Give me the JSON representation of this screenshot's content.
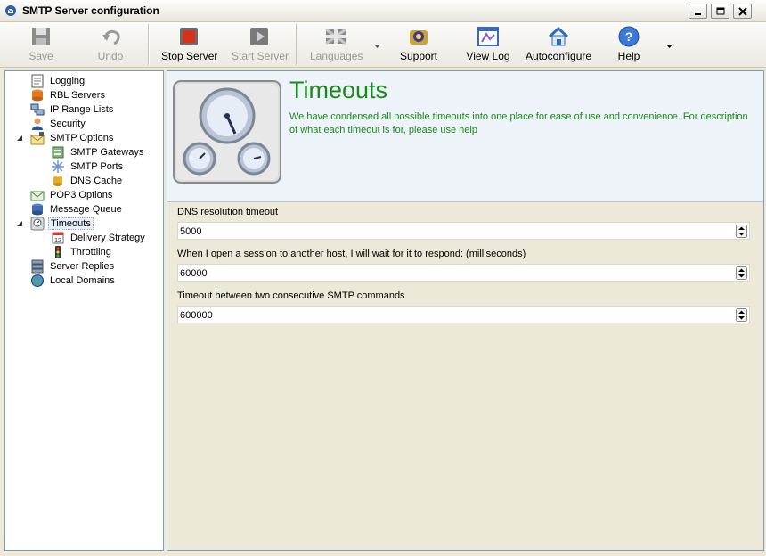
{
  "window": {
    "title": "SMTP Server configuration"
  },
  "toolbar": {
    "save": "Save",
    "undo": "Undo",
    "stop_server": "Stop Server",
    "start_server": "Start Server",
    "languages": "Languages",
    "support": "Support",
    "view_log": "View Log",
    "autoconfigure": "Autoconfigure",
    "help": "Help"
  },
  "tree": {
    "logging": "Logging",
    "rbl_servers": "RBL Servers",
    "ip_range_lists": "IP Range Lists",
    "security": "Security",
    "smtp_options": "SMTP Options",
    "smtp_gateways": "SMTP Gateways",
    "smtp_ports": "SMTP Ports",
    "dns_cache": "DNS Cache",
    "pop3_options": "POP3 Options",
    "message_queue": "Message Queue",
    "timeouts": "Timeouts",
    "delivery_strategy": "Delivery Strategy",
    "throttling": "Throttling",
    "server_replies": "Server Replies",
    "local_domains": "Local Domains"
  },
  "main": {
    "title": "Timeouts",
    "description": "We have condensed all possible timeouts into one place for ease of use and convenience. For description of what each  timeout is for, please use help",
    "fields": [
      {
        "label": "DNS resolution timeout",
        "value": "5000"
      },
      {
        "label": "When I open a session to another host, I will wait for it to respond: (milliseconds)",
        "value": "60000"
      },
      {
        "label": "Timeout between two consecutive SMTP commands",
        "value": "600000"
      }
    ]
  },
  "colors": {
    "accent_green": "#198a19",
    "header_bg": "#eef3fa",
    "window_bg": "#ece9d8"
  }
}
